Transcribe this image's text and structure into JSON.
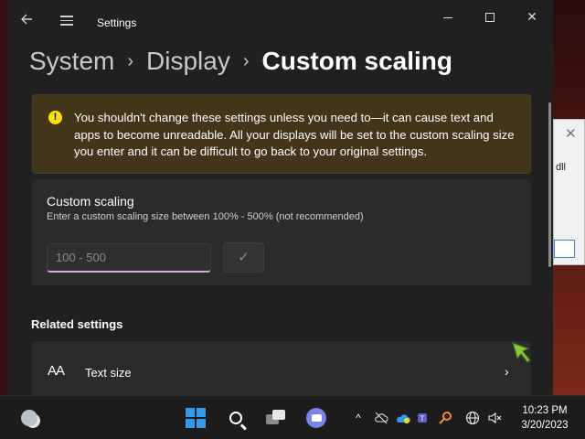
{
  "window": {
    "app_title": "Settings",
    "controls": {
      "minimize": "",
      "maximize": "",
      "close": "✕"
    }
  },
  "breadcrumb": {
    "items": [
      "System",
      "Display",
      "Custom scaling"
    ],
    "separator": "›"
  },
  "warning": {
    "icon": "!",
    "text": "You shouldn't change these settings unless you need to—it can cause text and apps to become unreadable. All your displays will be set to the custom scaling size you enter and it can be difficult to go back to your original settings."
  },
  "custom_scaling": {
    "title": "Custom scaling",
    "subtitle": "Enter a custom scaling size between 100% - 500% (not recommended)",
    "input_value": "",
    "input_placeholder": "100 - 500",
    "apply_icon": "✓"
  },
  "related": {
    "heading": "Related settings",
    "items": [
      {
        "icon_glyph": "AA",
        "label": "Text size",
        "chevron": "›"
      }
    ]
  },
  "background_dialog": {
    "close": "✕",
    "text": "dll"
  },
  "taskbar": {
    "tray_chevron": "^",
    "tray_icons": [
      "cloud-off-icon",
      "onedrive-icon",
      "shield-icon",
      "teams-icon",
      "search-key-icon",
      "globe-icon",
      "volume-muted-icon"
    ],
    "time": "10:23 PM",
    "date": "3/20/2023"
  },
  "colors": {
    "accent": "#d5a8e8",
    "warning_bg": "#433519",
    "warning_icon": "#fce100",
    "start_blue": "#2f9bf0",
    "window_bg": "#202020",
    "card_bg": "#2b2b2b"
  }
}
